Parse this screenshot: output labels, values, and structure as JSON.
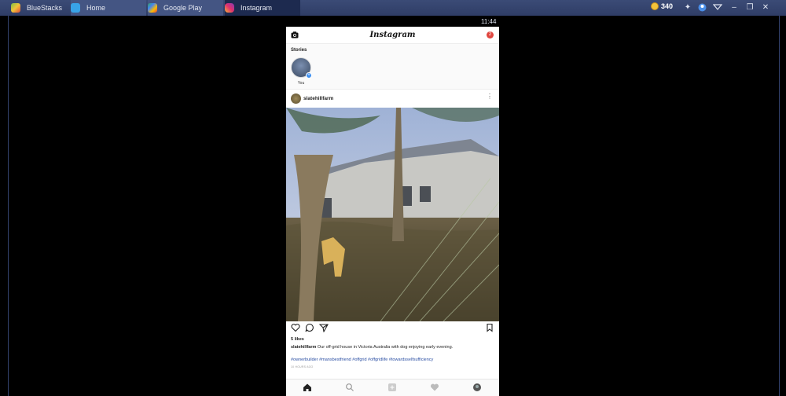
{
  "tabs": [
    {
      "label": "BlueStacks"
    },
    {
      "label": "Home"
    },
    {
      "label": "Google Play"
    },
    {
      "label": "Instagram"
    }
  ],
  "titlebar": {
    "coins": "340"
  },
  "status": {
    "time": "11:44"
  },
  "instagram": {
    "logo": "Instagram",
    "notification_count": "2",
    "stories_title": "Stories",
    "story_you": "You",
    "post": {
      "username": "slatehillfarm",
      "likes": "5 likes",
      "caption_user": "slatehillfarm",
      "caption_text": " Our off-grid house in Victoria Australia with dog enjoying early evening.",
      "hashtags": "#ownerbuilder #mansbestfriend #offgrid #offgridlife #towardsselfsufficiency",
      "time_ago": "10 HOURS AGO"
    }
  },
  "colors": {
    "accent": "#2f3d66",
    "link": "#2b4fa3",
    "badge": "#e0463f"
  }
}
